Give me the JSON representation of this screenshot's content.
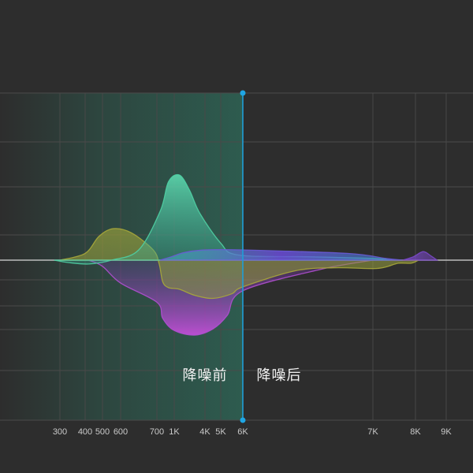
{
  "chart_data": {
    "type": "area",
    "title": "",
    "xlabel": "",
    "ylabel": "",
    "x_ticks": [
      300,
      400,
      500,
      600,
      700,
      1000,
      4000,
      5000,
      6000,
      7000,
      8000,
      9000
    ],
    "x_tick_labels": [
      "300",
      "400",
      "500",
      "600",
      "700",
      "1K",
      "4K",
      "5K",
      "6K",
      "7K",
      "8K",
      "9K"
    ],
    "grid": true,
    "divider": {
      "x": 6000,
      "left_label": "降噪前",
      "right_label": "降噪后"
    },
    "series": [
      {
        "color": "#4fd0a4",
        "points": [
          [
            280,
            0
          ],
          [
            330,
            -0.03
          ],
          [
            420,
            -0.05
          ],
          [
            550,
            0
          ],
          [
            650,
            0.12
          ],
          [
            760,
            0.58
          ],
          [
            900,
            0.92
          ],
          [
            1500,
            1.0
          ],
          [
            2500,
            0.82
          ],
          [
            3500,
            0.55
          ],
          [
            5000,
            0.2
          ],
          [
            5800,
            0.06
          ],
          [
            6500,
            0.04
          ],
          [
            7000,
            0.02
          ],
          [
            7400,
            0
          ]
        ]
      },
      {
        "color": "#a8a83a",
        "points": [
          [
            300,
            0
          ],
          [
            400,
            0.08
          ],
          [
            480,
            0.28
          ],
          [
            560,
            0.37
          ],
          [
            630,
            0.32
          ],
          [
            690,
            0.12
          ],
          [
            740,
            -0.05
          ],
          [
            800,
            -0.28
          ],
          [
            900,
            -0.36
          ],
          [
            1500,
            -0.38
          ],
          [
            3000,
            -0.46
          ],
          [
            4500,
            -0.5
          ],
          [
            5500,
            -0.44
          ],
          [
            6000,
            -0.35
          ],
          [
            6400,
            -0.14
          ],
          [
            6700,
            -0.1
          ],
          [
            7000,
            -0.11
          ],
          [
            7300,
            -0.09
          ],
          [
            7600,
            -0.04
          ],
          [
            7900,
            -0.04
          ],
          [
            8100,
            0
          ]
        ]
      },
      {
        "color": "#b04fd0",
        "points": [
          [
            420,
            0
          ],
          [
            500,
            -0.08
          ],
          [
            600,
            -0.3
          ],
          [
            700,
            -0.55
          ],
          [
            800,
            -0.76
          ],
          [
            1000,
            -0.92
          ],
          [
            3000,
            -0.98
          ],
          [
            4500,
            -0.9
          ],
          [
            5300,
            -0.72
          ],
          [
            6000,
            -0.4
          ],
          [
            6600,
            -0.12
          ],
          [
            7000,
            0
          ]
        ]
      },
      {
        "color": "#6a5ad6",
        "points": [
          [
            750,
            0
          ],
          [
            950,
            0.04
          ],
          [
            2000,
            0.09
          ],
          [
            4000,
            0.12
          ],
          [
            6000,
            0.12
          ],
          [
            6800,
            0.08
          ],
          [
            7300,
            0.02
          ],
          [
            7700,
            0
          ]
        ]
      },
      {
        "color": "#7a48c8",
        "points": [
          [
            7700,
            0
          ],
          [
            7950,
            0.04
          ],
          [
            8250,
            0.1
          ],
          [
            8500,
            0.05
          ],
          [
            8700,
            0
          ]
        ]
      }
    ]
  }
}
